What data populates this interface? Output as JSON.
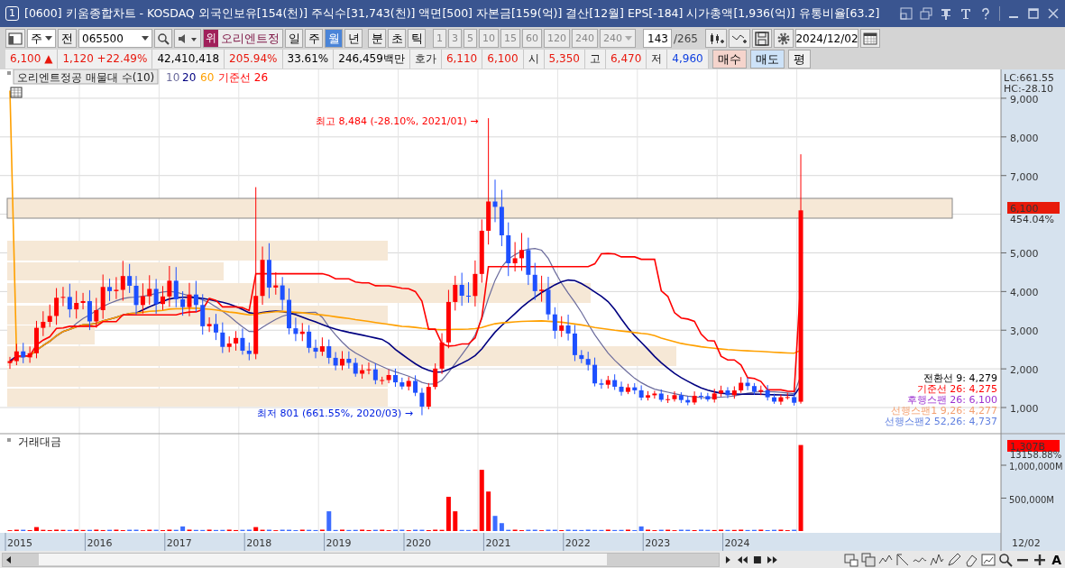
{
  "window": {
    "badge": "1",
    "title": "[0600] 키움종합차트 - KOSDAQ 외국인보유[154(천)] 주식수[31,743(천)] 액면[500] 자본금[159(억)] 결산[12월] EPS[-184] 시가총액[1,936(억)] 유통비율[63.2]"
  },
  "toolbar": {
    "market": "주",
    "prev": "전",
    "code": "065500",
    "name_badge": "위",
    "name": "오리엔트정",
    "periods": [
      {
        "label": "일",
        "selected": false
      },
      {
        "label": "주",
        "selected": false
      },
      {
        "label": "월",
        "selected": true
      },
      {
        "label": "년",
        "selected": false
      },
      {
        "label": "분",
        "selected": false
      },
      {
        "label": "초",
        "selected": false
      },
      {
        "label": "틱",
        "selected": false
      }
    ],
    "intervals": [
      "1",
      "3",
      "5",
      "10",
      "15",
      "60",
      "120",
      "240"
    ],
    "interval_select": "240",
    "count": "143",
    "total": "/265",
    "date": "2024/12/02"
  },
  "quote": [
    {
      "kind": "value",
      "text": "6,100 ▲",
      "color": "#e8170c"
    },
    {
      "kind": "value",
      "text": "1,120 +22.49%",
      "color": "#e8170c"
    },
    {
      "kind": "value",
      "text": "42,410,418",
      "color": "#000000"
    },
    {
      "kind": "value",
      "text": "205.94%",
      "color": "#e8170c"
    },
    {
      "kind": "value",
      "text": "33.61%",
      "color": "#000000"
    },
    {
      "kind": "value",
      "text": "246,459백만",
      "color": "#000000"
    },
    {
      "kind": "label",
      "text": "호가"
    },
    {
      "kind": "value",
      "text": "6,110",
      "color": "#e8170c"
    },
    {
      "kind": "value",
      "text": "6,100",
      "color": "#e8170c"
    },
    {
      "kind": "label",
      "text": "시"
    },
    {
      "kind": "value",
      "text": "5,350",
      "color": "#e8170c"
    },
    {
      "kind": "label",
      "text": "고"
    },
    {
      "kind": "value",
      "text": "6,470",
      "color": "#e8170c"
    },
    {
      "kind": "label",
      "text": "저"
    },
    {
      "kind": "value",
      "text": "4,960",
      "color": "#1040e0"
    }
  ],
  "order_buttons": [
    {
      "label": "매수",
      "kind": "buy"
    },
    {
      "label": "매도",
      "kind": "sell"
    },
    {
      "label": "평",
      "kind": "plain"
    }
  ],
  "price_panel": {
    "title": "오리엔트정공 매물대 수(10)",
    "legend": [
      {
        "label": "10",
        "color": "#6b6b9c"
      },
      {
        "label": "20",
        "color": "#000080"
      },
      {
        "label": "60",
        "color": "#ffa000"
      },
      {
        "label": "기준선 26",
        "color": "#ff0000"
      }
    ],
    "lc": "LC:661.55",
    "hc": "HC:-28.10",
    "yticks": [
      "9,000",
      "8,000",
      "7,000",
      "5,000",
      "4,000",
      "3,000",
      "2,000",
      "1,000"
    ],
    "price_tag": "6,100",
    "price_pct": "454.04%",
    "high_note": "최고 8,484 (-28.10%, 2021/01) →",
    "low_note": "최저 801 (661.55%, 2020/03) →",
    "ichimoku": [
      {
        "label": "전환선 9: 4,279",
        "color": "#000000"
      },
      {
        "label": "기준선 26: 4,275",
        "color": "#ff0000"
      },
      {
        "label": "후행스팬 26: 6,100",
        "color": "#9b30d0"
      },
      {
        "label": "선행스팬1 9,26: 4,277",
        "color": "#f4a070"
      },
      {
        "label": "선행스팬2 52,26: 4,737",
        "color": "#6080e0"
      }
    ]
  },
  "volume_panel": {
    "title": "거래대금",
    "tag": "1,307B",
    "pct": "13158.88%",
    "yticks": [
      "1,000,000M",
      "500,000M"
    ]
  },
  "x_axis": {
    "years": [
      "2015",
      "2016",
      "2017",
      "2018",
      "2019",
      "2020",
      "2021",
      "2022",
      "2023",
      "2024"
    ],
    "cursor_date": "12/02"
  },
  "bottom_tools": {
    "font_button": "A"
  }
}
